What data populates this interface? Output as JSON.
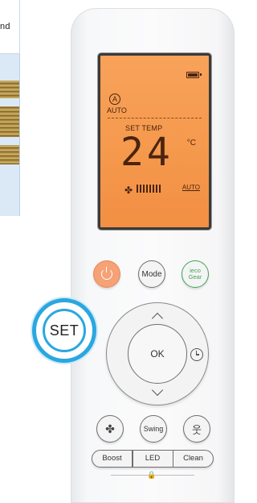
{
  "side_panel": {
    "text": "nd"
  },
  "lcd": {
    "mode_icon": "A",
    "mode_label": "AUTO",
    "set_temp_label": "SET TEMP",
    "temperature": "24",
    "unit": "°C",
    "fan_auto_label": "AUTO",
    "fan_level_bars": 8,
    "icons": [
      "battery-icon",
      "fan-icon"
    ]
  },
  "buttons": {
    "power_icon": "power-icon",
    "mode": "Mode",
    "eco_line1": "ieco",
    "eco_line2": "Gear",
    "ok": "OK",
    "swing": "Swing",
    "boost": "Boost",
    "led": "LED",
    "clean": "Clean"
  },
  "callout": {
    "label": "SET"
  },
  "colors": {
    "lcd_background": "#f59a4e",
    "power_button": "#f6a176",
    "eco_green": "#3fa656",
    "callout_blue": "#2aa7e0"
  }
}
